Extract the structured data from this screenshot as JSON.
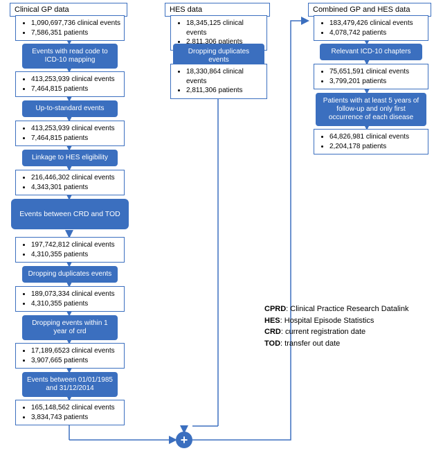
{
  "columns": {
    "gp": {
      "title": "Clinical GP data",
      "steps": [
        {
          "events": "1,090,697,736 clinical events",
          "patients": "7,586,351 patients"
        },
        {
          "proc": "Events with read code to ICD-10 mapping"
        },
        {
          "events": "413,253,939 clinical events",
          "patients": "7,464,815 patients"
        },
        {
          "proc": "Up-to-standard events"
        },
        {
          "events": "413,253,939 clinical events",
          "patients": "7,464,815 patients"
        },
        {
          "proc": "Linkage to HES eligibility"
        },
        {
          "events": "216,446,302 clinical events",
          "patients": "4,343,301 patients"
        },
        {
          "proc": "Events between CRD and TOD",
          "big": true
        },
        {
          "events": "197,742,812 clinical events",
          "patients": "4,310,355 patients"
        },
        {
          "proc": "Dropping duplicates events"
        },
        {
          "events": "189,073,334 clinical events",
          "patients": "4,310,355 patients"
        },
        {
          "proc": "Dropping events within 1 year of crd"
        },
        {
          "events": "17,189,6523 clinical events",
          "patients": "3,907,665 patients"
        },
        {
          "proc": "Events between 01/01/1985 and 31/12/2014"
        },
        {
          "events": "165,148,562 clinical events",
          "patients": "3,834,743 patients"
        }
      ]
    },
    "hes": {
      "title": "HES data",
      "steps": [
        {
          "events": "18,345,125 clinical events",
          "patients": "2,811,306 patients"
        },
        {
          "proc": "Dropping duplicates events"
        },
        {
          "events": "18,330,864 clinical events",
          "patients": "2,811,306 patients"
        }
      ]
    },
    "combined": {
      "title": "Combined GP and HES data",
      "steps": [
        {
          "events": "183,479,426 clinical events",
          "patients": "4,078,742 patients"
        },
        {
          "proc": "Relevant ICD-10 chapters"
        },
        {
          "events": "75,651,591 clinical events",
          "patients": "3,799,201 patients"
        },
        {
          "proc": "Patients with at least 5 years of follow-up  and only first occurrence of each disease"
        },
        {
          "events": "64,826,981 clinical events",
          "patients": "2,204,178 patients"
        }
      ]
    }
  },
  "merge_symbol": "+",
  "legend": [
    {
      "abbr": "CPRD",
      "full": "Clinical Practice Research Datalink"
    },
    {
      "abbr": "HES",
      "full": "Hospital Episode Statistics"
    },
    {
      "abbr": "CRD",
      "full": "current registration date"
    },
    {
      "abbr": "TOD",
      "full": "transfer out date"
    }
  ]
}
